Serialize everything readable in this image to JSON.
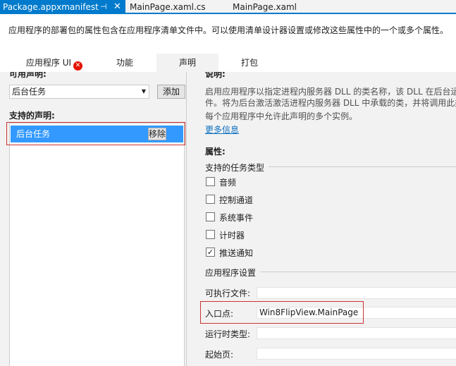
{
  "tabs": {
    "doc1": "Package.appxmanifest",
    "pin": "⊣",
    "close": "✕",
    "doc2": "MainPage.xaml.cs",
    "doc3": "MainPage.xaml"
  },
  "description": "应用程序的部署包的属性包含在应用程序清单文件中。可以使用清单设计器设置或修改这些属性中的一个或多个属性。",
  "section_tabs": {
    "app_ui": "应用程序 UI",
    "capabilities": "功能",
    "declarations": "声明",
    "packaging": "打包",
    "error_icon": "error-icon"
  },
  "left": {
    "available_label": "可用声明:",
    "available_value": "后台任务",
    "add_button": "添加",
    "supported_label": "支持的声明:",
    "supported_item": "后台任务",
    "remove_button": "移除"
  },
  "right": {
    "desc_label": "说明:",
    "desc_line1": "启用应用程序以指定进程内服务器 DLL 的类名称，该 DLL 在后台运",
    "desc_line2": "件。将为后台激活激活进程内服务器 DLL 中承载的类，并将调用此类",
    "desc_line3": "每个应用程序中允许此声明的多个实例。",
    "more_info": "更多信息",
    "properties_label": "属性:",
    "task_types_header": "支持的任务类型",
    "task_types": [
      {
        "label": "音频",
        "checked": false
      },
      {
        "label": "控制通道",
        "checked": false
      },
      {
        "label": "系统事件",
        "checked": false
      },
      {
        "label": "计时器",
        "checked": false
      },
      {
        "label": "推送通知",
        "checked": true
      }
    ],
    "app_settings_header": "应用程序设置",
    "executable_label": "可执行文件:",
    "executable_value": "",
    "entry_point_label": "入口点:",
    "entry_point_value": "Win8FlipView.MainPage",
    "runtime_type_label": "运行时类型:",
    "runtime_type_value": "",
    "start_page_label": "起始页:",
    "start_page_value": ""
  },
  "colors": {
    "accent": "#007acc",
    "selection": "#3399ff",
    "highlight": "#cc3333",
    "link": "#0e70c0"
  }
}
